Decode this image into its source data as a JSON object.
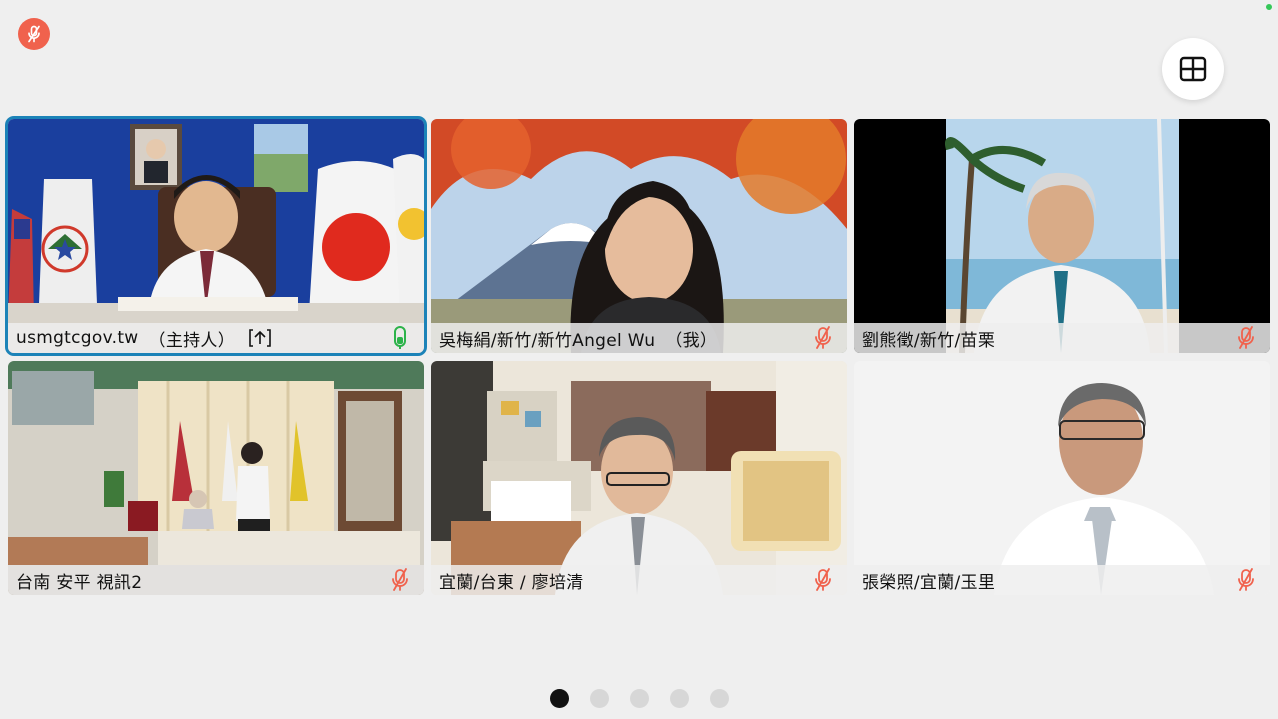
{
  "top_bar": {
    "self_mic_icon": "mic-muted-icon",
    "layout_icon": "grid-layout-icon"
  },
  "colors": {
    "accent": "#1c83b8",
    "muted_red": "#f0624d",
    "active_green": "#2cb34a"
  },
  "tiles": [
    {
      "name": "usmgtcgov.tw",
      "tag": "（主持人）",
      "mic": "mic-active-icon",
      "active": true
    },
    {
      "name": "吳梅絹/新竹/新竹Angel Wu",
      "tag": "（我）",
      "mic": "mic-muted-icon"
    },
    {
      "name": "劉熊徵/新竹/苗栗",
      "mic": "mic-muted-icon"
    },
    {
      "name": "台南 安平 視訊2",
      "mic": "mic-muted-icon"
    },
    {
      "name": "宜蘭/台東 / 廖培清",
      "mic": "mic-muted-icon"
    },
    {
      "name": "張榮照/宜蘭/玉里",
      "mic": "mic-muted-icon"
    }
  ],
  "pager": {
    "pages": 5,
    "current": 1
  }
}
